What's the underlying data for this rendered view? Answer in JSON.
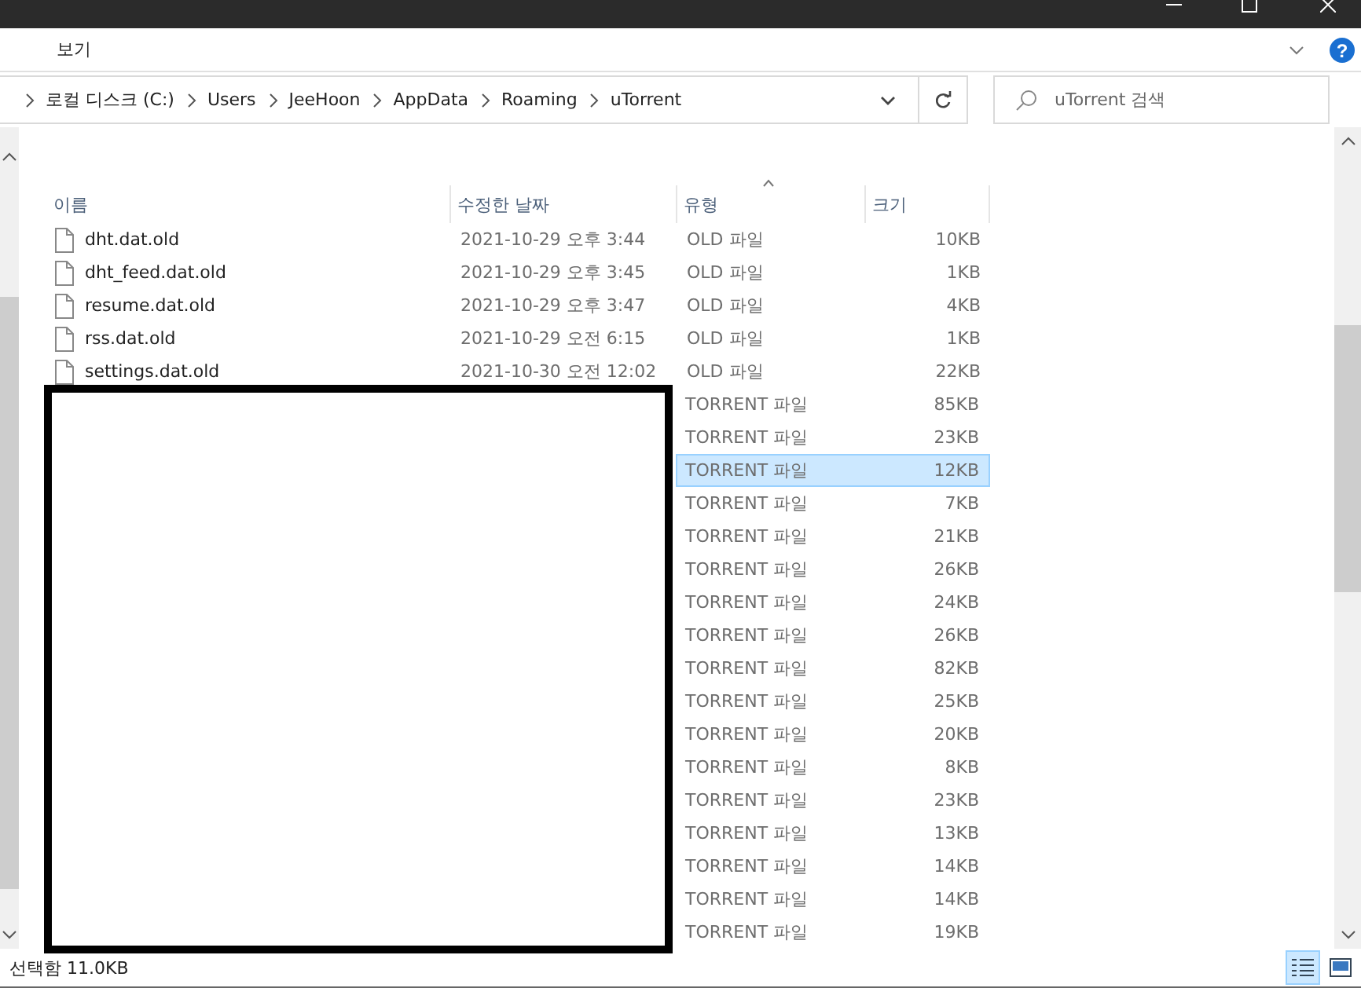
{
  "ribbon": {
    "tabs": [
      {
        "label": "보기",
        "selected": false
      }
    ]
  },
  "address": {
    "crumbs": [
      "로컬 디스크 (C:)",
      "Users",
      "JeeHoon",
      "AppData",
      "Roaming",
      "uTorrent"
    ]
  },
  "help": {
    "label": "?"
  },
  "search": {
    "placeholder": "uTorrent 검색"
  },
  "table": {
    "columns": [
      {
        "label": "이름",
        "sorted": false
      },
      {
        "label": "수정한 날짜",
        "sorted": false
      },
      {
        "label": "유형",
        "sorted": true
      },
      {
        "label": "크기",
        "sorted": false
      }
    ],
    "rows": [
      {
        "name": "dht.dat.old",
        "date": "2021-10-29 오후 3:44",
        "type": "OLD 파일",
        "size": "10KB",
        "selected": false
      },
      {
        "name": "dht_feed.dat.old",
        "date": "2021-10-29 오후 3:45",
        "type": "OLD 파일",
        "size": "1KB",
        "selected": false
      },
      {
        "name": "resume.dat.old",
        "date": "2021-10-29 오후 3:47",
        "type": "OLD 파일",
        "size": "4KB",
        "selected": false
      },
      {
        "name": "rss.dat.old",
        "date": "2021-10-29 오전 6:15",
        "type": "OLD 파일",
        "size": "1KB",
        "selected": false
      },
      {
        "name": "settings.dat.old",
        "date": "2021-10-30 오전 12:02",
        "type": "OLD 파일",
        "size": "22KB",
        "selected": false
      },
      {
        "type": "TORRENT 파일",
        "size": "85KB",
        "selected": false
      },
      {
        "type": "TORRENT 파일",
        "size": "23KB",
        "selected": false
      },
      {
        "type": "TORRENT 파일",
        "size": "12KB",
        "selected": true
      },
      {
        "type": "TORRENT 파일",
        "size": "7KB",
        "selected": false
      },
      {
        "type": "TORRENT 파일",
        "size": "21KB",
        "selected": false
      },
      {
        "type": "TORRENT 파일",
        "size": "26KB",
        "selected": false
      },
      {
        "type": "TORRENT 파일",
        "size": "24KB",
        "selected": false
      },
      {
        "type": "TORRENT 파일",
        "size": "26KB",
        "selected": false
      },
      {
        "type": "TORRENT 파일",
        "size": "82KB",
        "selected": false
      },
      {
        "type": "TORRENT 파일",
        "size": "25KB",
        "selected": false
      },
      {
        "type": "TORRENT 파일",
        "size": "20KB",
        "selected": false
      },
      {
        "type": "TORRENT 파일",
        "size": "8KB",
        "selected": false
      },
      {
        "type": "TORRENT 파일",
        "size": "23KB",
        "selected": false
      },
      {
        "type": "TORRENT 파일",
        "size": "13KB",
        "selected": false
      },
      {
        "type": "TORRENT 파일",
        "size": "14KB",
        "selected": false
      },
      {
        "type": "TORRENT 파일",
        "size": "14KB",
        "selected": false
      },
      {
        "type": "TORRENT 파일",
        "size": "19KB",
        "selected": false
      }
    ]
  },
  "status_bar": {
    "text": "선택함 11.0KB"
  }
}
